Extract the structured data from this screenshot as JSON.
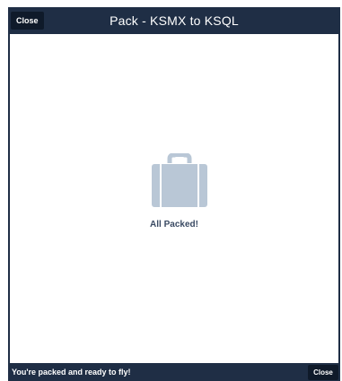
{
  "header": {
    "title": "Pack - KSMX to KSQL",
    "close_label": "Close"
  },
  "main": {
    "icon": "suitcase-icon",
    "message": "All Packed!"
  },
  "footer": {
    "status": "You're packed and ready to fly!",
    "close_label": "Close"
  },
  "colors": {
    "bar": "#1f2e45",
    "button": "#0f1a2a",
    "icon": "#b9c7d6",
    "message": "#3a4a63"
  }
}
